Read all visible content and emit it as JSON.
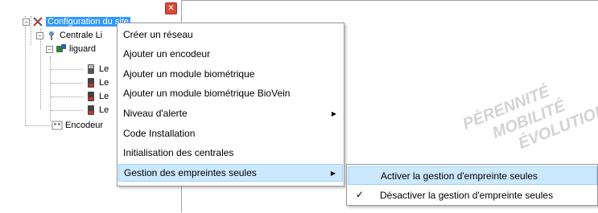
{
  "tree": {
    "close_glyph": "✕",
    "items": [
      {
        "label": "Configuration du site",
        "icon": "tools-icon",
        "expander": "−"
      },
      {
        "label": "Centrale Li",
        "icon": "network-icon",
        "expander": "−"
      },
      {
        "label": "liguard",
        "icon": "device-icon",
        "expander": "−"
      },
      {
        "label": "Le",
        "icon": "reader-icon"
      },
      {
        "label": "Le",
        "icon": "reader-icon"
      },
      {
        "label": "Le",
        "icon": "reader-icon"
      },
      {
        "label": "Le",
        "icon": "reader-icon"
      },
      {
        "label": "Encodeur",
        "icon": "encoder-icon"
      }
    ]
  },
  "context_menu": {
    "items": [
      {
        "label": "Créer un réseau"
      },
      {
        "label": "Ajouter un encodeur"
      },
      {
        "label": "Ajouter un module biométrique"
      },
      {
        "label": "Ajouter un module biométrique BioVein"
      },
      {
        "label": "Niveau d'alerte",
        "has_submenu": true
      },
      {
        "label": "Code Installation"
      },
      {
        "label": "Initialisation des centrales"
      },
      {
        "label": "Gestion des empreintes seules",
        "has_submenu": true,
        "highlighted": true
      }
    ],
    "submenu_arrow": "▶"
  },
  "submenu": {
    "items": [
      {
        "label": "Activer la gestion d'empreinte seules",
        "highlighted": true
      },
      {
        "label": "Désactiver la gestion d'empreinte seules",
        "checked": true
      }
    ],
    "check_glyph": "✓"
  },
  "watermark": {
    "lines": [
      "PÉRENNITÉ",
      "MOBILITÉ",
      "ÉVOLUTION"
    ]
  },
  "colors": {
    "selection": "#3399ff",
    "menu_highlight": "#cce8ff",
    "menu_highlight_border": "#99d1ff"
  }
}
